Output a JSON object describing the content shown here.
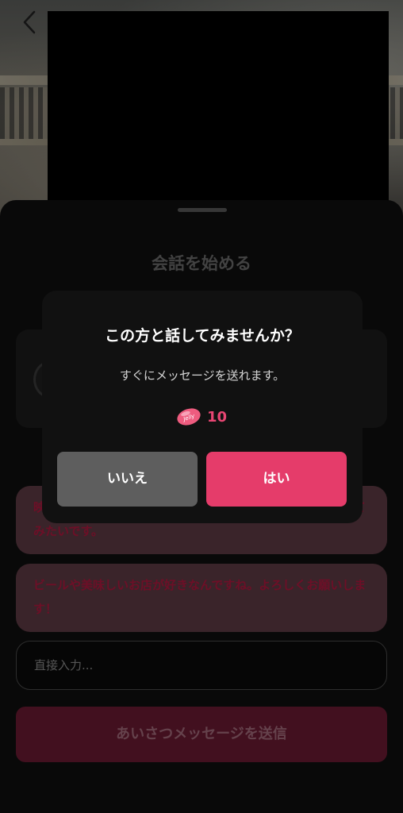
{
  "nav": {
    "back_icon": "chevron-left-icon"
  },
  "sheet": {
    "title": "会話を始める",
    "greeting_options": [
      "映画を観るのがお好きなんですね。私もです！今度一緒に観てみたいです。",
      "ビールや美味しいお店が好きなんですね。よろしくお願いします！"
    ],
    "direct_input_placeholder": "直接入力...",
    "send_label": "あいさつメッセージを送信"
  },
  "dialog": {
    "title": "この方と話してみませんか？",
    "subtitle": "すぐにメッセージを送れます。",
    "cost_icon_text": "Jelly",
    "cost": "10",
    "no_label": "いいえ",
    "yes_label": "はい"
  },
  "colors": {
    "accent": "#e53c6a",
    "cost": "#e84673",
    "dialog_bg": "#111111",
    "no_button": "#5e5e5e"
  }
}
